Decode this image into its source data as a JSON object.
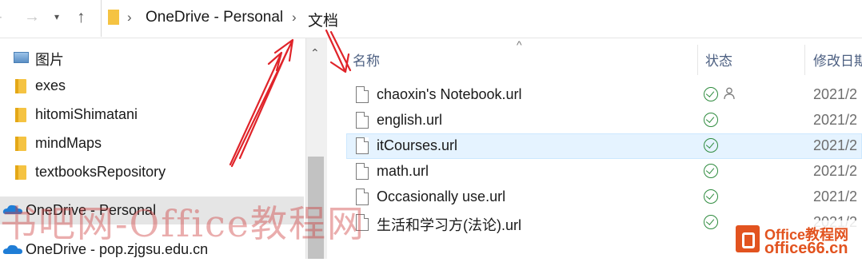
{
  "address_bar": {
    "path": [
      "OneDrive - Personal",
      "文档"
    ]
  },
  "sidebar": {
    "items": [
      {
        "label": "图片",
        "icon": "pictures-icon"
      },
      {
        "label": "exes",
        "icon": "folder-icon"
      },
      {
        "label": "hitomiShimatani",
        "icon": "folder-icon"
      },
      {
        "label": "mindMaps",
        "icon": "folder-icon"
      },
      {
        "label": "textbooksRepository",
        "icon": "folder-icon"
      },
      {
        "label": "OneDrive - Personal",
        "icon": "onedrive-cloud-icon",
        "selected": true
      },
      {
        "label": "OneDrive - pop.zjgsu.edu.cn",
        "icon": "onedrive-cloud-icon"
      }
    ]
  },
  "columns": {
    "name": "名称",
    "status": "状态",
    "modified": "修改日期"
  },
  "files": [
    {
      "name": "chaoxin's Notebook.url",
      "date": "2021/2",
      "status": "synced",
      "shared": true
    },
    {
      "name": "english.url",
      "date": "2021/2",
      "status": "synced"
    },
    {
      "name": "itCourses.url",
      "date": "2021/2",
      "status": "synced",
      "highlighted": true
    },
    {
      "name": "math.url",
      "date": "2021/2",
      "status": "synced"
    },
    {
      "name": "Occasionally use.url",
      "date": "2021/2",
      "status": "synced"
    },
    {
      "name": "生活和学习方(法论).url",
      "date": "2021/2",
      "status": "synced"
    }
  ],
  "watermark": {
    "text": "书吧网-Office教程网",
    "logo_line1": "Office教程网",
    "logo_line2": "office66.cn"
  },
  "colors": {
    "accent_blue": "#4d6082",
    "sync_green": "#2e8b3e",
    "annotation_red": "#e0242a",
    "logo_orange": "#e2531f"
  }
}
